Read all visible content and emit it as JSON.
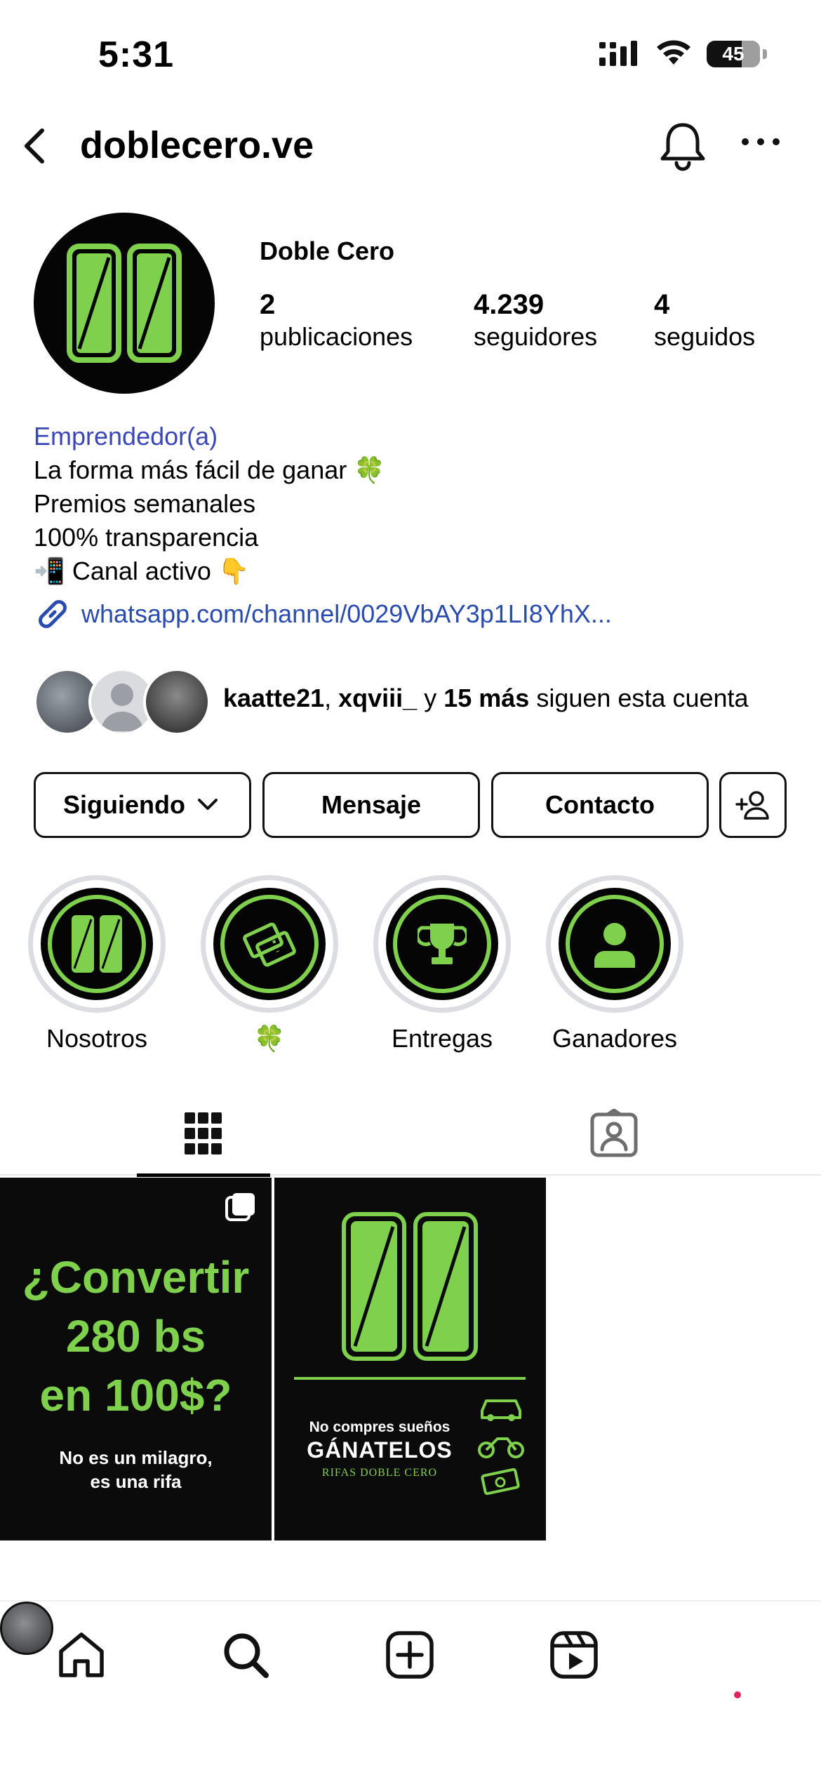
{
  "status_bar": {
    "time": "5:31",
    "battery": "45"
  },
  "header": {
    "username": "doblecero.ve"
  },
  "profile": {
    "display_name": "Doble Cero",
    "stats": [
      {
        "value": "2",
        "label": "publicaciones"
      },
      {
        "value": "4.239",
        "label": "seguidores"
      },
      {
        "value": "4",
        "label": "seguidos"
      }
    ]
  },
  "bio": {
    "category": "Emprendedor(a)",
    "lines": [
      "La forma más fácil de ganar 🍀",
      "Premios semanales",
      "100% transparencia",
      "📲 Canal activo  👇"
    ],
    "link": "whatsapp.com/channel/0029VbAY3p1LI8YhX..."
  },
  "followed_by": {
    "user1": "kaatte21",
    "sep": ", ",
    "user2": "xqviii_",
    "conj": " y ",
    "more": "15 más",
    "suffix": " siguen esta cuenta"
  },
  "buttons": {
    "following": "Siguiendo",
    "message": "Mensaje",
    "contact": "Contacto"
  },
  "highlights": [
    {
      "label": "Nosotros"
    },
    {
      "label": "🍀"
    },
    {
      "label": "Entregas"
    },
    {
      "label": "Ganadores"
    }
  ],
  "posts": {
    "post1": {
      "headline_1": "¿Convertir",
      "headline_2": "280 bs",
      "headline_3": "en 100$?",
      "sub_1": "No es un milagro,",
      "sub_2": "es una rifa"
    },
    "post2": {
      "line1": "No compres sueños",
      "line2": "GÁNATELOS",
      "line3": "RIFAS DOBLE CERO"
    }
  },
  "colors": {
    "brand_green": "#7fd04d",
    "link_blue": "#2a4cae",
    "category_blue": "#3b47b8"
  }
}
